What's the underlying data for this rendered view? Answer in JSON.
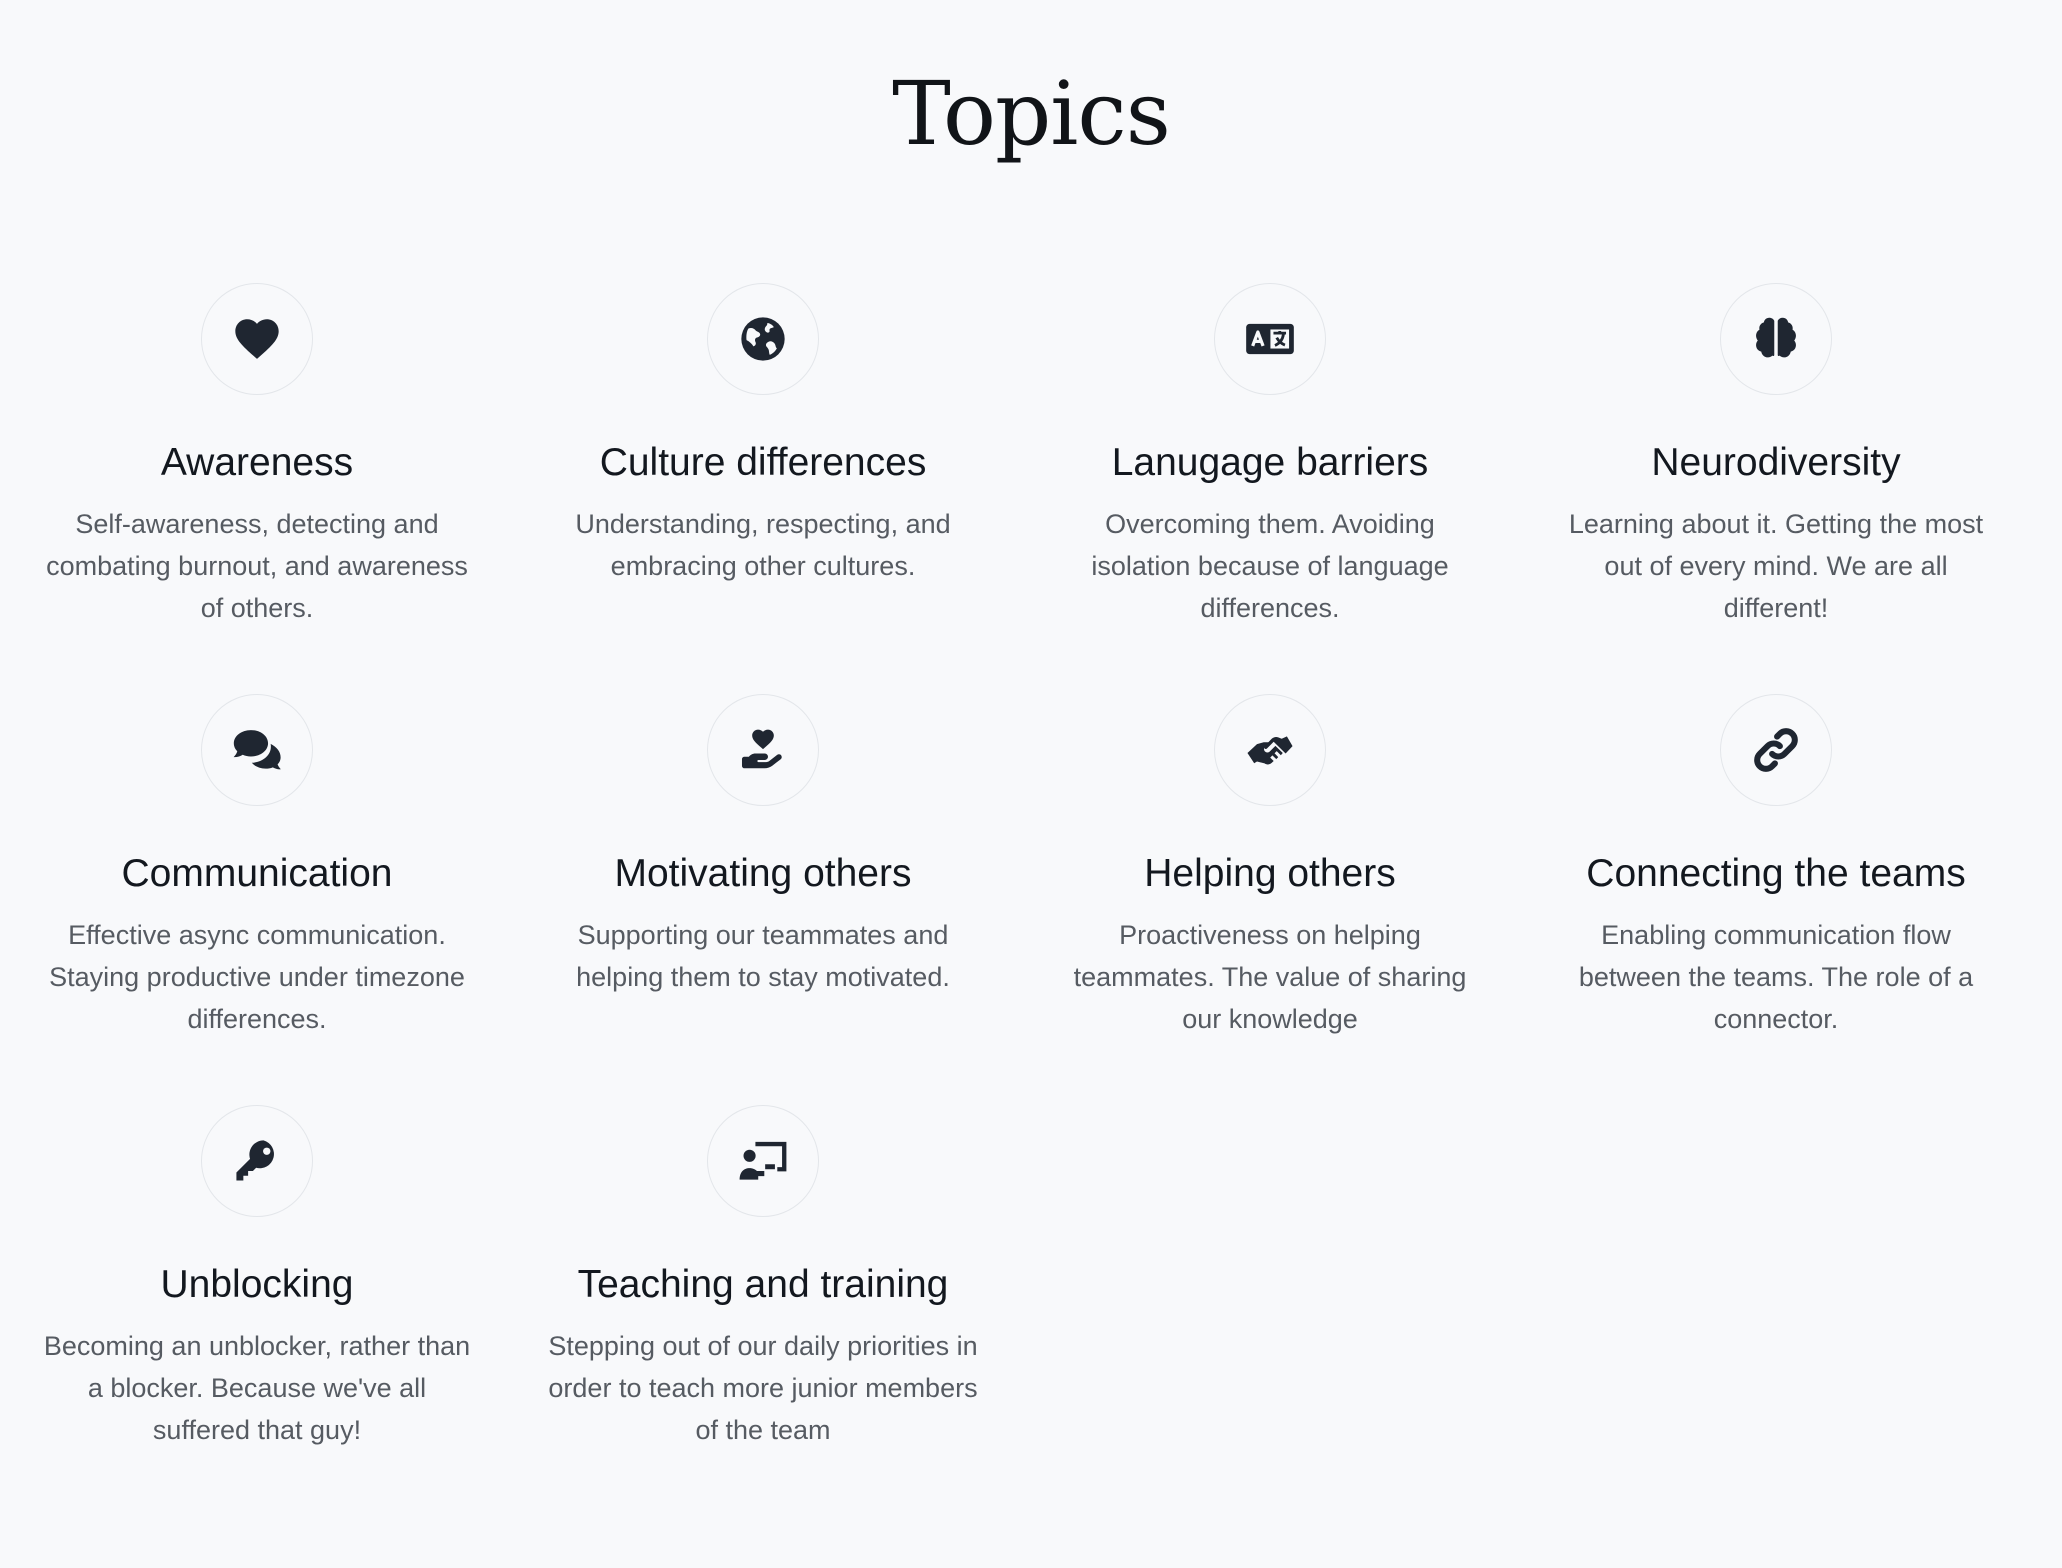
{
  "page": {
    "title": "Topics",
    "background_color": "#f8f9fb",
    "icon_color": "#1f2631"
  },
  "topics": [
    {
      "title": "Awareness",
      "description": "Self-awareness, detecting and combating burnout, and awareness of others.",
      "icon": "heart-icon"
    },
    {
      "title": "Culture differences",
      "description": "Understanding, respecting, and embracing other cultures.",
      "icon": "globe-icon"
    },
    {
      "title": "Lanugage barriers",
      "description": "Overcoming them. Avoiding isolation because of language differences.",
      "icon": "language-icon"
    },
    {
      "title": "Neurodiversity",
      "description": "Learning about it. Getting the most out of every mind. We are all different!",
      "icon": "brain-icon"
    },
    {
      "title": "Communication",
      "description": "Effective async communication. Staying productive under timezone differences.",
      "icon": "chat-bubbles-icon"
    },
    {
      "title": "Motivating others",
      "description": "Supporting our teammates and helping them to stay motivated.",
      "icon": "hand-holding-heart-icon"
    },
    {
      "title": "Helping others",
      "description": "Proactiveness on helping teammates. The value of sharing our knowledge",
      "icon": "handshake-icon"
    },
    {
      "title": "Connecting the teams",
      "description": "Enabling communication flow between the teams. The role of a connector.",
      "icon": "link-icon"
    },
    {
      "title": "Unblocking",
      "description": "Becoming an unblocker, rather than a blocker. Because we've all suffered that guy!",
      "icon": "key-icon"
    },
    {
      "title": "Teaching and training",
      "description": "Stepping out of our daily priorities in order to teach more junior members of the team",
      "icon": "chalkboard-teacher-icon"
    }
  ]
}
